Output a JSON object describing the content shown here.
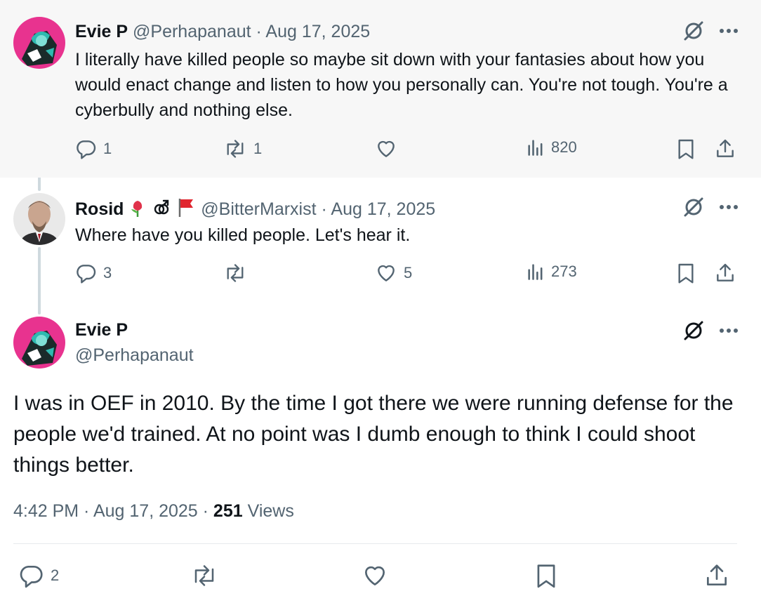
{
  "tweets": [
    {
      "name": "Evie P",
      "handle": "@Perhapanaut",
      "date": "Aug 17, 2025",
      "text": "I literally have killed people so maybe sit down with your fantasies about how you would enact change and listen to how you personally can. You're not tough. You're a cyberbully and nothing else.",
      "replies": "1",
      "reposts": "1",
      "likes": "",
      "views": "820"
    },
    {
      "name": "Rosid",
      "handle": "@BitterMarxist",
      "date": "Aug 17, 2025",
      "text": "Where have you killed people. Let's hear it.",
      "replies": "3",
      "reposts": "",
      "likes": "5",
      "views": "273"
    }
  ],
  "main": {
    "name": "Evie P",
    "handle": "@Perhapanaut",
    "text": "I was in OEF in 2010. By the time I got there we were running defense for the people we'd trained. At no point was I dumb enough to think I could shoot things better.",
    "time": "4:42 PM",
    "date": "Aug 17, 2025",
    "views_count": "251",
    "views_label": "Views",
    "replies": "2"
  },
  "separator": " · ",
  "icons": {
    "reply": "reply-icon",
    "repost": "repost-icon",
    "like": "heart-icon",
    "views": "analytics-icon",
    "bookmark": "bookmark-icon",
    "share": "share-icon",
    "grok": "grok-icon",
    "more": "more-icon"
  },
  "colors": {
    "text": "#0f1419",
    "muted": "#536471",
    "highlight_bg": "#f7f7f7",
    "thread_line": "#cfd9de"
  }
}
